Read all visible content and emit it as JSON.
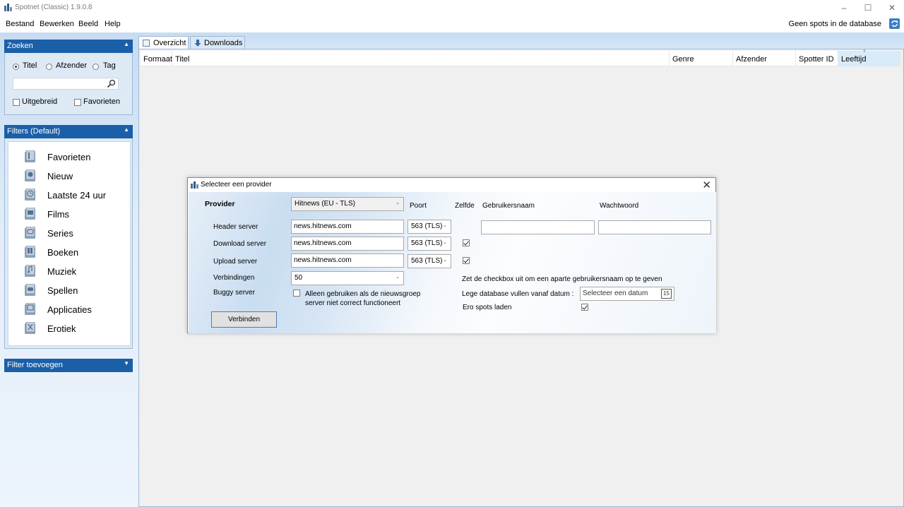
{
  "window": {
    "title": "Spotnet (Classic) 1.9.0.8"
  },
  "menu": {
    "items": [
      "Bestand",
      "Bewerken",
      "Beeld",
      "Help"
    ],
    "status": "Geen spots in de database"
  },
  "search_panel": {
    "header": "Zoeken",
    "radios": [
      "Titel",
      "Afzender",
      "Tag"
    ],
    "selected": "Titel",
    "search_value": "",
    "checkboxes": [
      "Uitgebreid",
      "Favorieten"
    ]
  },
  "filters_panel": {
    "header": "Filters (Default)",
    "items": [
      "Favorieten",
      "Nieuw",
      "Laatste 24 uur",
      "Films",
      "Series",
      "Boeken",
      "Muziek",
      "Spellen",
      "Applicaties",
      "Erotiek"
    ]
  },
  "add_filter_panel": {
    "header": "Filter toevoegen"
  },
  "tabs": [
    "Overzicht",
    "Downloads"
  ],
  "grid": {
    "columns": [
      "Formaat",
      "Titel",
      "Genre",
      "Afzender",
      "Spotter ID",
      "Leeftijd"
    ]
  },
  "dialog": {
    "title": "Selecteer een provider",
    "provider_label": "Provider",
    "provider_value": "Hitnews (EU - TLS)",
    "col_poort": "Poort",
    "col_zelfde": "Zelfde",
    "col_user": "Gebruikersnaam",
    "col_pass": "Wachtwoord",
    "header_server_label": "Header server",
    "header_server_value": "news.hitnews.com",
    "header_port": "563 (TLS)",
    "download_server_label": "Download server",
    "download_server_value": "news.hitnews.com",
    "download_port": "563 (TLS)",
    "upload_server_label": "Upload server",
    "upload_server_value": "news.hitnews.com",
    "upload_port": "563 (TLS)",
    "connections_label": "Verbindingen",
    "connections_value": "50",
    "buggy_label": "Buggy server",
    "buggy_text_1": "Alleen gebruiken als de nieuwsgroep",
    "buggy_text_2": "server niet correct functioneert",
    "username_value": "",
    "password_value": "",
    "checkbox_hint": "Zet de checkbox uit om een aparte gebruikersnaam op te geven",
    "date_label": "Lege database vullen vanaf datum :",
    "date_placeholder": "Selecteer een datum",
    "date_icon_text": "15",
    "ero_label": "Ero spots laden",
    "connect_button": "Verbinden"
  }
}
